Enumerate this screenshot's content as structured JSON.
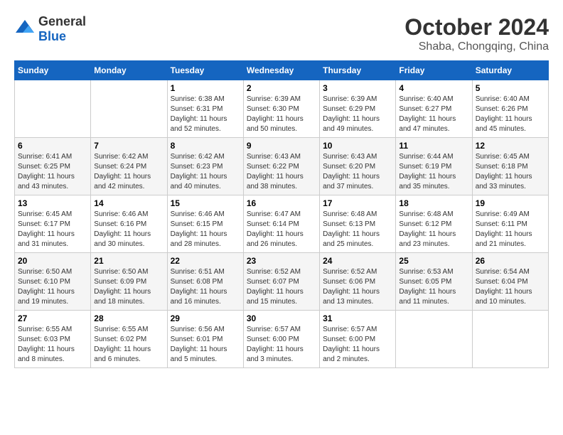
{
  "logo": {
    "general": "General",
    "blue": "Blue"
  },
  "title": "October 2024",
  "location": "Shaba, Chongqing, China",
  "days_header": [
    "Sunday",
    "Monday",
    "Tuesday",
    "Wednesday",
    "Thursday",
    "Friday",
    "Saturday"
  ],
  "weeks": [
    [
      {
        "day": "",
        "sunrise": "",
        "sunset": "",
        "daylight": ""
      },
      {
        "day": "",
        "sunrise": "",
        "sunset": "",
        "daylight": ""
      },
      {
        "day": "1",
        "sunrise": "Sunrise: 6:38 AM",
        "sunset": "Sunset: 6:31 PM",
        "daylight": "Daylight: 11 hours and 52 minutes."
      },
      {
        "day": "2",
        "sunrise": "Sunrise: 6:39 AM",
        "sunset": "Sunset: 6:30 PM",
        "daylight": "Daylight: 11 hours and 50 minutes."
      },
      {
        "day": "3",
        "sunrise": "Sunrise: 6:39 AM",
        "sunset": "Sunset: 6:29 PM",
        "daylight": "Daylight: 11 hours and 49 minutes."
      },
      {
        "day": "4",
        "sunrise": "Sunrise: 6:40 AM",
        "sunset": "Sunset: 6:27 PM",
        "daylight": "Daylight: 11 hours and 47 minutes."
      },
      {
        "day": "5",
        "sunrise": "Sunrise: 6:40 AM",
        "sunset": "Sunset: 6:26 PM",
        "daylight": "Daylight: 11 hours and 45 minutes."
      }
    ],
    [
      {
        "day": "6",
        "sunrise": "Sunrise: 6:41 AM",
        "sunset": "Sunset: 6:25 PM",
        "daylight": "Daylight: 11 hours and 43 minutes."
      },
      {
        "day": "7",
        "sunrise": "Sunrise: 6:42 AM",
        "sunset": "Sunset: 6:24 PM",
        "daylight": "Daylight: 11 hours and 42 minutes."
      },
      {
        "day": "8",
        "sunrise": "Sunrise: 6:42 AM",
        "sunset": "Sunset: 6:23 PM",
        "daylight": "Daylight: 11 hours and 40 minutes."
      },
      {
        "day": "9",
        "sunrise": "Sunrise: 6:43 AM",
        "sunset": "Sunset: 6:22 PM",
        "daylight": "Daylight: 11 hours and 38 minutes."
      },
      {
        "day": "10",
        "sunrise": "Sunrise: 6:43 AM",
        "sunset": "Sunset: 6:20 PM",
        "daylight": "Daylight: 11 hours and 37 minutes."
      },
      {
        "day": "11",
        "sunrise": "Sunrise: 6:44 AM",
        "sunset": "Sunset: 6:19 PM",
        "daylight": "Daylight: 11 hours and 35 minutes."
      },
      {
        "day": "12",
        "sunrise": "Sunrise: 6:45 AM",
        "sunset": "Sunset: 6:18 PM",
        "daylight": "Daylight: 11 hours and 33 minutes."
      }
    ],
    [
      {
        "day": "13",
        "sunrise": "Sunrise: 6:45 AM",
        "sunset": "Sunset: 6:17 PM",
        "daylight": "Daylight: 11 hours and 31 minutes."
      },
      {
        "day": "14",
        "sunrise": "Sunrise: 6:46 AM",
        "sunset": "Sunset: 6:16 PM",
        "daylight": "Daylight: 11 hours and 30 minutes."
      },
      {
        "day": "15",
        "sunrise": "Sunrise: 6:46 AM",
        "sunset": "Sunset: 6:15 PM",
        "daylight": "Daylight: 11 hours and 28 minutes."
      },
      {
        "day": "16",
        "sunrise": "Sunrise: 6:47 AM",
        "sunset": "Sunset: 6:14 PM",
        "daylight": "Daylight: 11 hours and 26 minutes."
      },
      {
        "day": "17",
        "sunrise": "Sunrise: 6:48 AM",
        "sunset": "Sunset: 6:13 PM",
        "daylight": "Daylight: 11 hours and 25 minutes."
      },
      {
        "day": "18",
        "sunrise": "Sunrise: 6:48 AM",
        "sunset": "Sunset: 6:12 PM",
        "daylight": "Daylight: 11 hours and 23 minutes."
      },
      {
        "day": "19",
        "sunrise": "Sunrise: 6:49 AM",
        "sunset": "Sunset: 6:11 PM",
        "daylight": "Daylight: 11 hours and 21 minutes."
      }
    ],
    [
      {
        "day": "20",
        "sunrise": "Sunrise: 6:50 AM",
        "sunset": "Sunset: 6:10 PM",
        "daylight": "Daylight: 11 hours and 19 minutes."
      },
      {
        "day": "21",
        "sunrise": "Sunrise: 6:50 AM",
        "sunset": "Sunset: 6:09 PM",
        "daylight": "Daylight: 11 hours and 18 minutes."
      },
      {
        "day": "22",
        "sunrise": "Sunrise: 6:51 AM",
        "sunset": "Sunset: 6:08 PM",
        "daylight": "Daylight: 11 hours and 16 minutes."
      },
      {
        "day": "23",
        "sunrise": "Sunrise: 6:52 AM",
        "sunset": "Sunset: 6:07 PM",
        "daylight": "Daylight: 11 hours and 15 minutes."
      },
      {
        "day": "24",
        "sunrise": "Sunrise: 6:52 AM",
        "sunset": "Sunset: 6:06 PM",
        "daylight": "Daylight: 11 hours and 13 minutes."
      },
      {
        "day": "25",
        "sunrise": "Sunrise: 6:53 AM",
        "sunset": "Sunset: 6:05 PM",
        "daylight": "Daylight: 11 hours and 11 minutes."
      },
      {
        "day": "26",
        "sunrise": "Sunrise: 6:54 AM",
        "sunset": "Sunset: 6:04 PM",
        "daylight": "Daylight: 11 hours and 10 minutes."
      }
    ],
    [
      {
        "day": "27",
        "sunrise": "Sunrise: 6:55 AM",
        "sunset": "Sunset: 6:03 PM",
        "daylight": "Daylight: 11 hours and 8 minutes."
      },
      {
        "day": "28",
        "sunrise": "Sunrise: 6:55 AM",
        "sunset": "Sunset: 6:02 PM",
        "daylight": "Daylight: 11 hours and 6 minutes."
      },
      {
        "day": "29",
        "sunrise": "Sunrise: 6:56 AM",
        "sunset": "Sunset: 6:01 PM",
        "daylight": "Daylight: 11 hours and 5 minutes."
      },
      {
        "day": "30",
        "sunrise": "Sunrise: 6:57 AM",
        "sunset": "Sunset: 6:00 PM",
        "daylight": "Daylight: 11 hours and 3 minutes."
      },
      {
        "day": "31",
        "sunrise": "Sunrise: 6:57 AM",
        "sunset": "Sunset: 6:00 PM",
        "daylight": "Daylight: 11 hours and 2 minutes."
      },
      {
        "day": "",
        "sunrise": "",
        "sunset": "",
        "daylight": ""
      },
      {
        "day": "",
        "sunrise": "",
        "sunset": "",
        "daylight": ""
      }
    ]
  ]
}
